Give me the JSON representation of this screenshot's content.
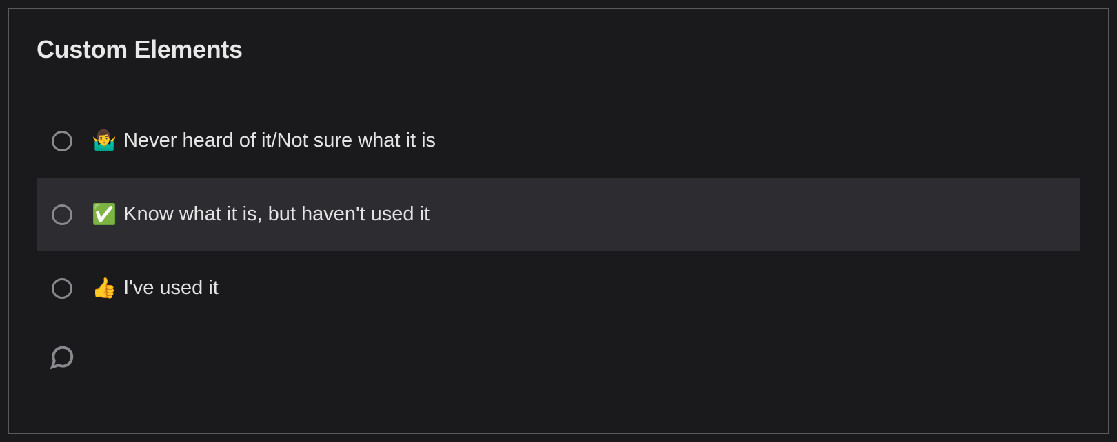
{
  "question": {
    "title": "Custom Elements",
    "options": [
      {
        "emoji": "🤷‍♂️",
        "label": "Never heard of it/Not sure what it is",
        "highlighted": false
      },
      {
        "emoji": "✅",
        "label": "Know what it is, but haven't used it",
        "highlighted": true
      },
      {
        "emoji": "👍",
        "label": "I've used it",
        "highlighted": false
      }
    ]
  }
}
